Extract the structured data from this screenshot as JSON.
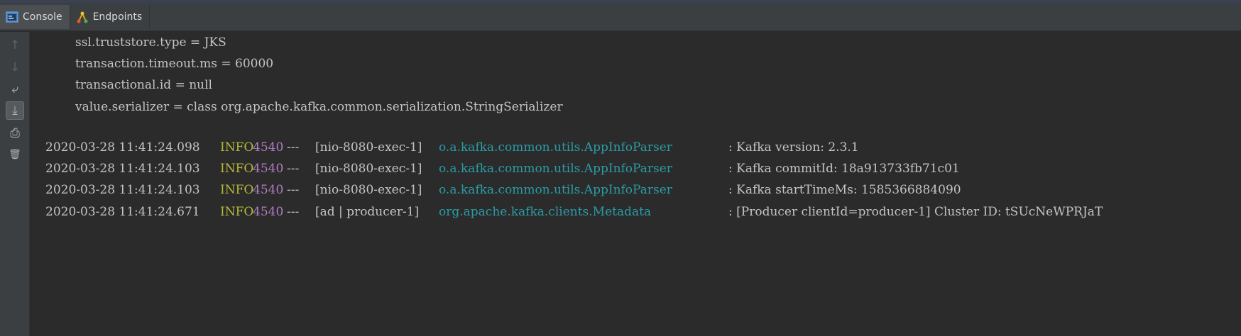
{
  "tabs": [
    {
      "label": "Console",
      "icon": "console-icon",
      "active": true
    },
    {
      "label": "Endpoints",
      "icon": "endpoints-icon",
      "active": false
    }
  ],
  "gutter": [
    {
      "icon": "arrow-up-icon",
      "glyph": "↑",
      "state": "disabled"
    },
    {
      "icon": "arrow-down-icon",
      "glyph": "↓",
      "state": "disabled"
    },
    {
      "icon": "soft-wrap-icon",
      "glyph": "⤶",
      "state": "normal"
    },
    {
      "icon": "scroll-to-end-icon",
      "glyph": "⤓",
      "state": "pressed"
    },
    {
      "icon": "print-icon",
      "glyph": "⎙",
      "state": "normal"
    },
    {
      "icon": "trash-icon",
      "glyph": "🗑",
      "state": "normal"
    }
  ],
  "console": {
    "properties": [
      "ssl.truststore.type = JKS",
      "transaction.timeout.ms = 60000",
      "transactional.id = null",
      "value.serializer = class org.apache.kafka.common.serialization.StringSerializer"
    ],
    "logs": [
      {
        "timestamp": "2020-03-28 11:41:24.098",
        "level": "INFO",
        "pid": "4540",
        "sep": "---",
        "thread": "[nio-8080-exec-1]",
        "logger": "o.a.kafka.common.utils.AppInfoParser",
        "message": ": Kafka version: 2.3.1"
      },
      {
        "timestamp": "2020-03-28 11:41:24.103",
        "level": "INFO",
        "pid": "4540",
        "sep": "---",
        "thread": "[nio-8080-exec-1]",
        "logger": "o.a.kafka.common.utils.AppInfoParser",
        "message": ": Kafka commitId: 18a913733fb71c01"
      },
      {
        "timestamp": "2020-03-28 11:41:24.103",
        "level": "INFO",
        "pid": "4540",
        "sep": "---",
        "thread": "[nio-8080-exec-1]",
        "logger": "o.a.kafka.common.utils.AppInfoParser",
        "message": ": Kafka startTimeMs: 1585366884090"
      },
      {
        "timestamp": "2020-03-28 11:41:24.671",
        "level": "INFO",
        "pid": "4540",
        "sep": "---",
        "thread": "[ad | producer-1]",
        "logger": "org.apache.kafka.clients.Metadata",
        "message": ": [Producer clientId=producer-1] Cluster ID: tSUcNeWPRJaT"
      }
    ]
  },
  "colors": {
    "background": "#2b2b2b",
    "level_info": "#b8b83a",
    "pid": "#b07cc0",
    "logger": "#2a9ca6",
    "text": "#c4c4c4"
  }
}
